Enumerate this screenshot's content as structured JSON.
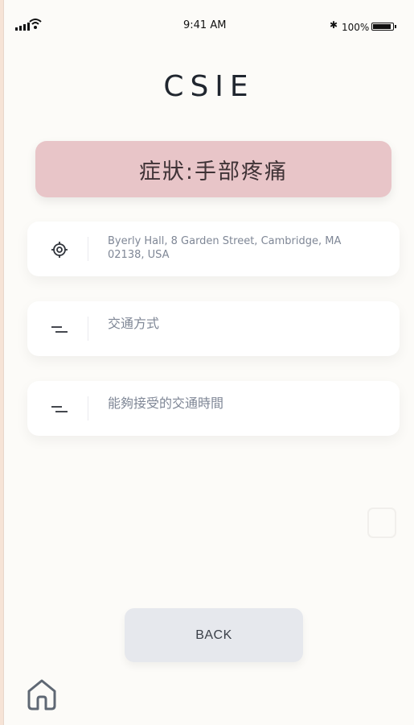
{
  "status_bar": {
    "time": "9:41 AM",
    "battery": "100%",
    "icons": [
      "signal-icon",
      "wifi-icon",
      "bluetooth-icon",
      "battery-icon"
    ]
  },
  "app": {
    "brand": "CSIE"
  },
  "symptom": {
    "label": "症狀:手部疼痛"
  },
  "fields": {
    "location": {
      "icon": "target-icon",
      "value": "Byerly Hall, 8 Garden Street, Cambridge, MA 02138, USA"
    },
    "transport": {
      "icon": "menu-icon",
      "label": "交通方式"
    },
    "travel_time": {
      "icon": "menu-icon",
      "label": "能夠接受的交通時間"
    }
  },
  "actions": {
    "back": "BACK"
  },
  "navigation": {
    "home_icon": "home-icon"
  },
  "colors": {
    "page_background": "#fcfbf8",
    "outer_background": "#f6e3d6",
    "symptom_background": "#e8c5c8",
    "button_background": "#e6e8ed",
    "text": "#20262f",
    "muted_text": "#7f8796"
  }
}
